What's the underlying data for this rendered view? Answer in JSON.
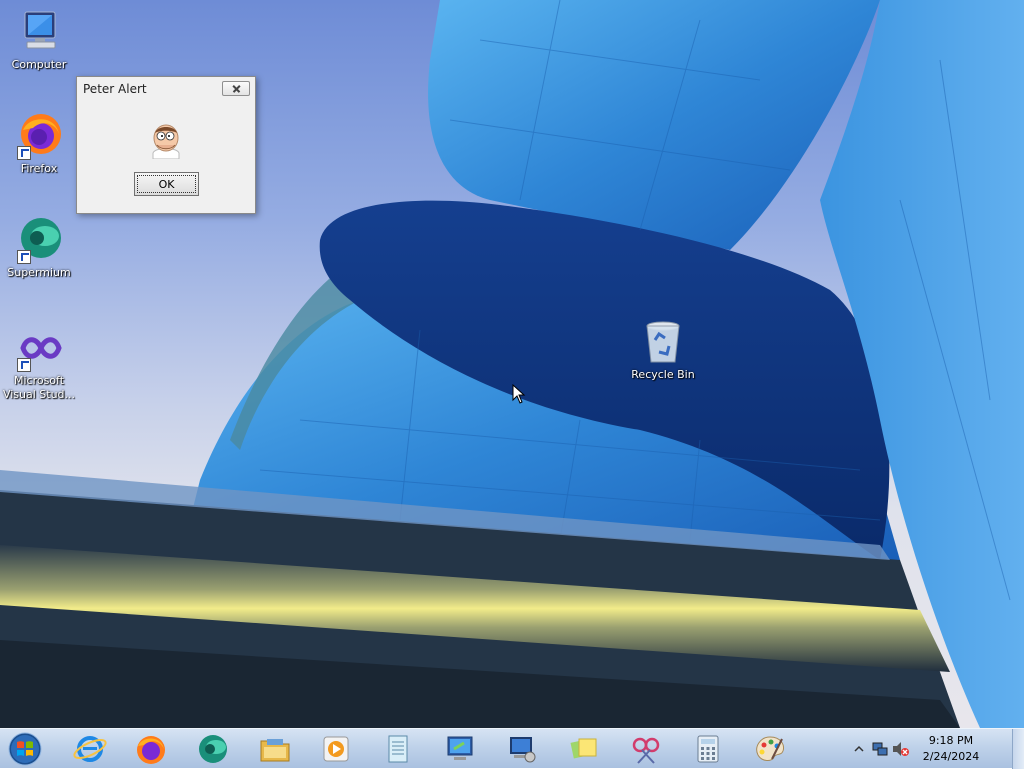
{
  "desktop": {
    "icons": [
      {
        "label": "Computer",
        "icon": "computer-icon"
      },
      {
        "label": "Firefox",
        "icon": "firefox-icon"
      },
      {
        "label": "Supermium",
        "icon": "supermium-icon"
      },
      {
        "label": "Microsoft Visual Stud...",
        "label_line1": "Microsoft",
        "label_line2": "Visual Stud...",
        "icon": "visual-studio-icon"
      },
      {
        "label": "Recycle Bin",
        "icon": "recycle-bin-icon"
      }
    ]
  },
  "alert": {
    "title": "Peter Alert",
    "ok_label": "OK",
    "icon": "peter-face-icon"
  },
  "taskbar": {
    "pinned": [
      {
        "name": "internet-explorer",
        "icon": "ie-icon"
      },
      {
        "name": "firefox",
        "icon": "firefox-icon"
      },
      {
        "name": "supermium",
        "icon": "supermium-icon"
      },
      {
        "name": "file-explorer",
        "icon": "folder-icon"
      },
      {
        "name": "media-player",
        "icon": "media-player-icon"
      },
      {
        "name": "notepad",
        "icon": "notepad-icon"
      },
      {
        "name": "remote-desktop",
        "icon": "remote-desktop-icon"
      },
      {
        "name": "network-computer",
        "icon": "network-computer-icon"
      },
      {
        "name": "sticky-notes",
        "icon": "sticky-notes-icon"
      },
      {
        "name": "snipping-tool",
        "icon": "scissors-icon"
      },
      {
        "name": "calculator",
        "icon": "calculator-icon"
      },
      {
        "name": "paint",
        "icon": "paint-palette-icon"
      }
    ],
    "clock": {
      "time": "9:18 PM",
      "date": "2/24/2024"
    }
  },
  "colors": {
    "taskbar": "#bfd2ea",
    "wallpaper_blue": "#2f7fd0",
    "wallpaper_dark": "#0c3a86",
    "accent_yellow": "#e8e070"
  }
}
